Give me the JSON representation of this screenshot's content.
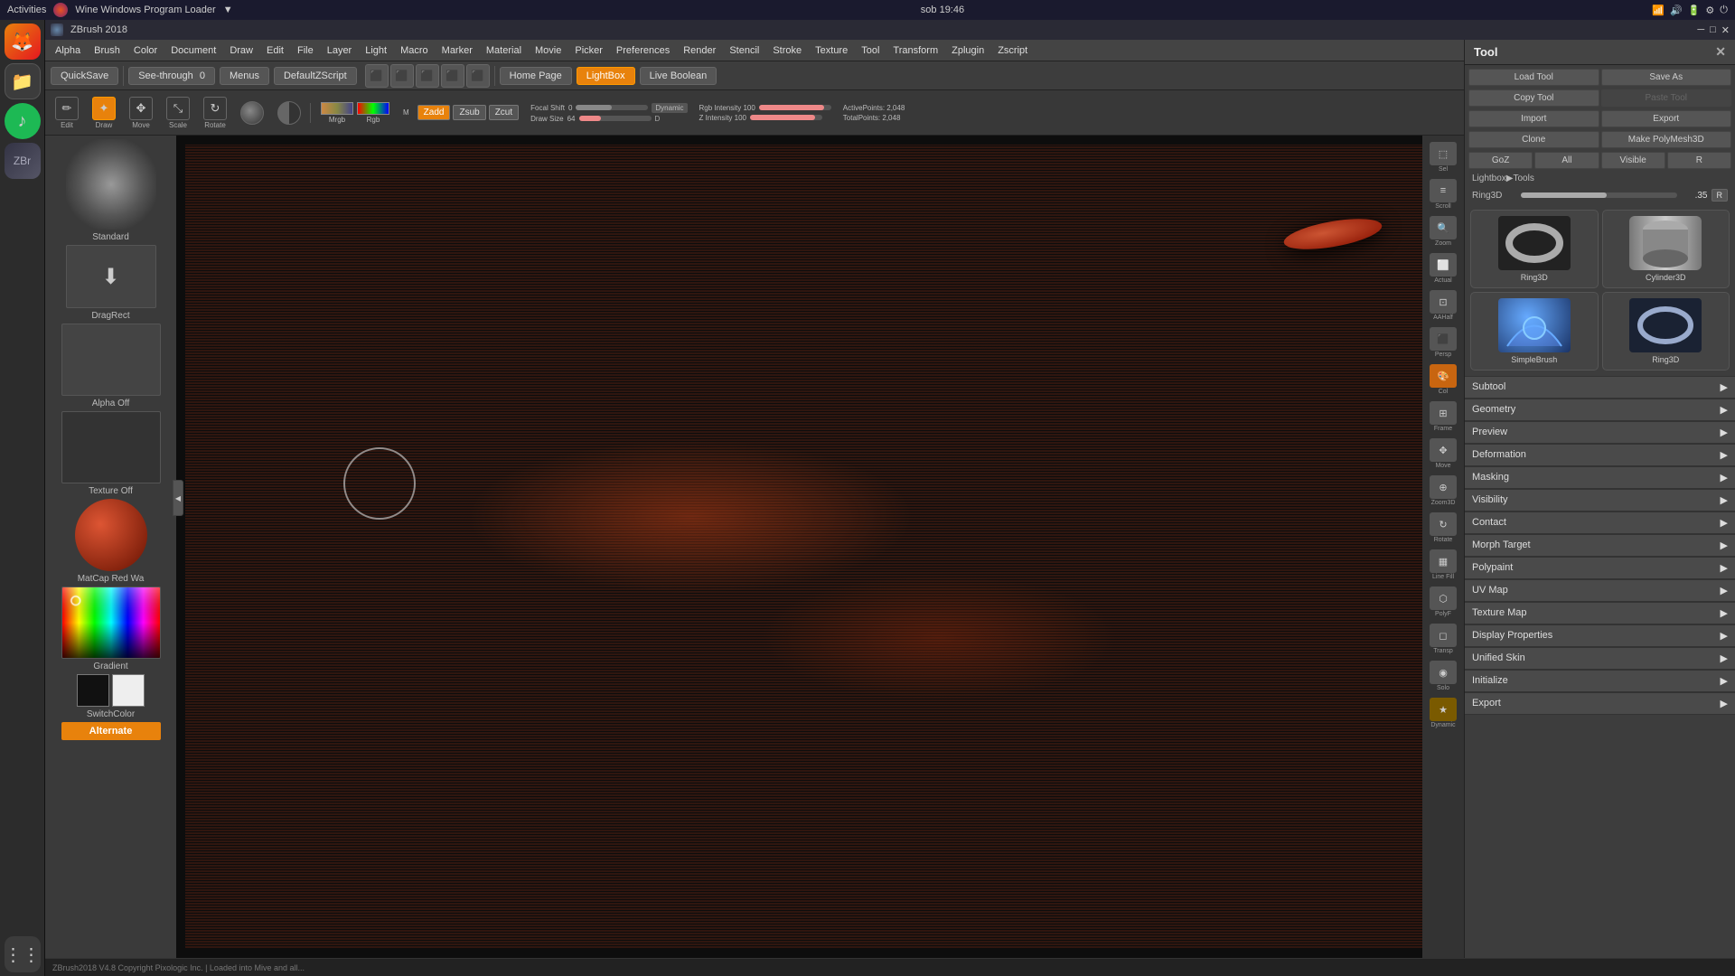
{
  "system": {
    "topbar_app": "Wine Windows Program Loader",
    "topbar_time": "sob 19:46",
    "topbar_title": "ZBrush 2018"
  },
  "menubar": {
    "items": [
      "Alpha",
      "Brush",
      "Color",
      "Document",
      "Draw",
      "Edit",
      "File",
      "Layer",
      "Light",
      "Macro",
      "Marker",
      "Material",
      "Movie",
      "Picker",
      "Preferences",
      "Render",
      "Stencil",
      "Stroke",
      "Texture",
      "Tool",
      "Transform",
      "Zplugin",
      "Zscript"
    ]
  },
  "quickbar": {
    "quicksave": "QuickSave",
    "see_through": "See-through",
    "see_through_val": "0",
    "menus": "Menus",
    "default_zscript": "DefaultZScript",
    "home_page": "Home Page",
    "lightbox": "LightBox",
    "live_boolean": "Live Boolean"
  },
  "brushbar": {
    "tools": [
      "Edit",
      "Draw",
      "Move",
      "Scale",
      "Rotate"
    ],
    "active_tool": "Draw",
    "mrgb_label": "Mrgb",
    "rgb_label": "Rgb",
    "m_label": "M",
    "zadd_label": "Zadd",
    "zsub_label": "Zsub",
    "zcut_label": "Zcut",
    "focal_shift": "Focal Shift 0",
    "draw_size": "Draw Size 64",
    "dynamic_label": "Dynamic",
    "active_points": "ActivePoints: 2,048",
    "total_points": "TotalPoints: 2,048",
    "rgb_intensity": "Rgb Intensity 100",
    "z_intensity": "Z Intensity 100"
  },
  "left_panel": {
    "standard_label": "Standard",
    "drag_rect_label": "DragRect",
    "alpha_label": "Alpha Off",
    "texture_label": "Texture Off",
    "matcap_label": "MatCap Red Wa",
    "gradient_label": "Gradient",
    "switch_color_label": "SwitchColor",
    "alternate_label": "Alternate"
  },
  "right_panel": {
    "title": "Tool",
    "load_tool": "Load Tool",
    "save_as": "Save As",
    "copy_tool": "Copy Tool",
    "paste_tool": "Paste Tool",
    "import": "Import",
    "export": "Export",
    "clone": "Clone",
    "make_polymesh3d": "Make PolyMesh3D",
    "goz": "GoZ",
    "all": "All",
    "visible": "Visible",
    "r_label": "R",
    "lightbox_tools": "Lightbox▶Tools",
    "ring3d_label": "Ring3D",
    "ring3d_val": ".35",
    "r_btn": "R",
    "tools": [
      {
        "name": "Ring3D",
        "type": "ring"
      },
      {
        "name": "Cylinder3D",
        "type": "cylinder"
      },
      {
        "name": "SimpleBrush",
        "type": "simple"
      },
      {
        "name": "Ring3D",
        "type": "ring2"
      }
    ],
    "sections": [
      "Subtool",
      "Geometry",
      "Preview",
      "Deformation",
      "Masking",
      "Visibility",
      "Contact",
      "Morph Target",
      "Polypaint",
      "UV Map",
      "Texture Map",
      "Display Properties",
      "Unified Skin",
      "Initialize",
      "Export"
    ]
  },
  "right_icons": [
    {
      "label": "Sel",
      "type": "default"
    },
    {
      "label": "Scroll",
      "type": "default"
    },
    {
      "label": "Zoom",
      "type": "default"
    },
    {
      "label": "Actual",
      "type": "default"
    },
    {
      "label": "AAHalf",
      "type": "default"
    },
    {
      "label": "Persp",
      "type": "default"
    },
    {
      "label": "Col",
      "type": "orange"
    },
    {
      "label": "Frame",
      "type": "default"
    },
    {
      "label": "Move",
      "type": "default"
    },
    {
      "label": "Zoom3D",
      "type": "default"
    },
    {
      "label": "Rotate",
      "type": "default"
    },
    {
      "label": "Line Fill",
      "type": "default"
    },
    {
      "label": "PolyF",
      "type": "default"
    },
    {
      "label": "Transp",
      "type": "default"
    },
    {
      "label": "Solo",
      "type": "default"
    },
    {
      "label": "Dynamic",
      "type": "golden"
    }
  ],
  "status_bar": {
    "message": "ZBrush2018 V4.8 Copyright Pixologic Inc. | Loaded into Mive and all..."
  }
}
